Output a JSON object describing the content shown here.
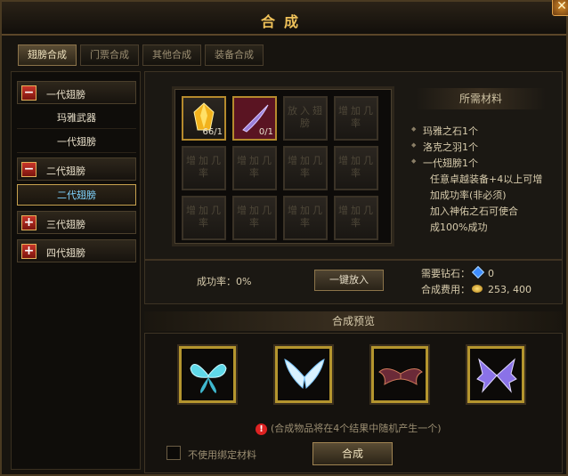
{
  "window": {
    "title": "合成",
    "close_icon": "close-x-icon"
  },
  "tabs": [
    {
      "label": "翅膀合成",
      "active": true
    },
    {
      "label": "门票合成",
      "active": false
    },
    {
      "label": "其他合成",
      "active": false
    },
    {
      "label": "装备合成",
      "active": false
    }
  ],
  "sidebar": {
    "categories": [
      {
        "label": "一代翅膀",
        "state": "expanded",
        "icon": "minus-icon",
        "children": [
          "玛雅武器",
          "一代翅膀"
        ]
      },
      {
        "label": "二代翅膀",
        "state": "expanded",
        "icon": "minus-icon",
        "children": [
          "二代翅膀"
        ],
        "selected_child": "二代翅膀"
      },
      {
        "label": "三代翅膀",
        "state": "collapsed",
        "icon": "plus-icon"
      },
      {
        "label": "四代翅膀",
        "state": "collapsed",
        "icon": "plus-icon"
      }
    ]
  },
  "grid": {
    "slots": [
      {
        "type": "item",
        "item": "玛雅之石",
        "count": "66/1"
      },
      {
        "type": "item",
        "item": "洛克之羽",
        "count": "0/1"
      },
      {
        "type": "empty",
        "text": "放入翅膀"
      },
      {
        "type": "empty",
        "text": "增加几率"
      },
      {
        "type": "empty",
        "text": "增加几率"
      },
      {
        "type": "empty",
        "text": "增加几率"
      },
      {
        "type": "empty",
        "text": "增加几率"
      },
      {
        "type": "empty",
        "text": "增加几率"
      },
      {
        "type": "empty",
        "text": "增加几率"
      },
      {
        "type": "empty",
        "text": "增加几率"
      },
      {
        "type": "empty",
        "text": "增加几率"
      },
      {
        "type": "empty",
        "text": "增加几率"
      }
    ]
  },
  "materials": {
    "title": "所需材料",
    "items": [
      "玛雅之石1个",
      "洛克之羽1个",
      "一代翅膀1个"
    ],
    "notes": [
      "任意卓越装备+4以上可增",
      "加成功率(非必须)",
      "加入神佑之石可使合",
      "成100%成功"
    ]
  },
  "stats": {
    "success_label": "成功率：",
    "success_value": "0%",
    "one_key_button": "一键放入",
    "diamond_label": "需要钻石：",
    "diamond_value": "0",
    "cost_label": "合成费用：",
    "cost_value": "253, 400"
  },
  "preview": {
    "title": "合成预览",
    "wings": [
      "cyan-butterfly-wings",
      "white-blue-feather-wings",
      "dark-red-demon-wings",
      "purple-crystal-wings"
    ],
    "notice": "(合成物品将在4个结果中随机产生一个)",
    "checkbox_label": "不使用绑定材料",
    "combine_button": "合成"
  },
  "colors": {
    "accent": "#f0c25a",
    "frame_gold": "#b4952e",
    "selected_text": "#7fd4ff"
  }
}
